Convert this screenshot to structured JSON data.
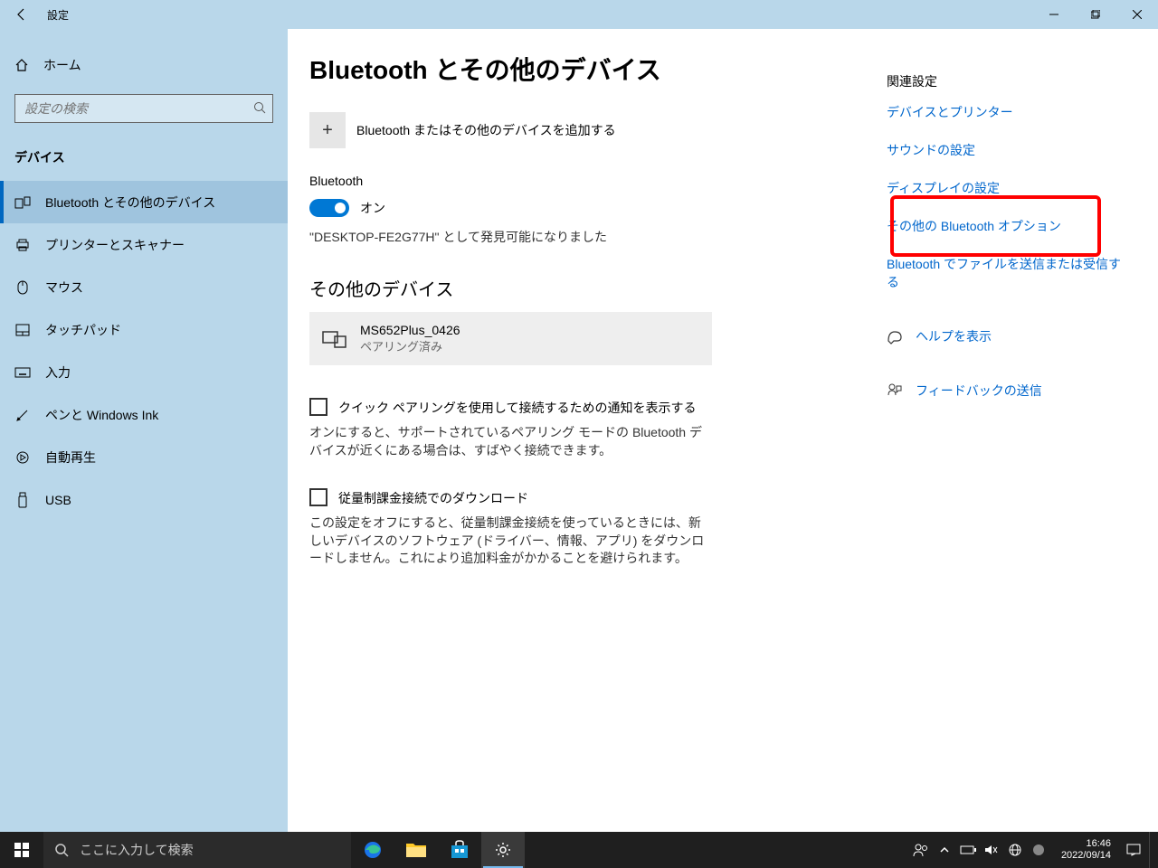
{
  "titlebar": {
    "title": "設定"
  },
  "sidebar": {
    "home": "ホーム",
    "search_placeholder": "設定の検索",
    "category": "デバイス",
    "items": [
      {
        "label": "Bluetooth とその他のデバイス"
      },
      {
        "label": "プリンターとスキャナー"
      },
      {
        "label": "マウス"
      },
      {
        "label": "タッチパッド"
      },
      {
        "label": "入力"
      },
      {
        "label": "ペンと Windows Ink"
      },
      {
        "label": "自動再生"
      },
      {
        "label": "USB"
      }
    ]
  },
  "content": {
    "heading": "Bluetooth とその他のデバイス",
    "add_device": "Bluetooth またはその他のデバイスを追加する",
    "bluetooth_label": "Bluetooth",
    "toggle_state": "オン",
    "discoverable": "\"DESKTOP-FE2G77H\" として発見可能になりました",
    "other_devices_heading": "その他のデバイス",
    "device": {
      "name": "MS652Plus_0426",
      "status": "ペアリング済み"
    },
    "quick_pair_label": "クイック ペアリングを使用して接続するための通知を表示する",
    "quick_pair_desc": "オンにすると、サポートされているペアリング モードの Bluetooth デバイスが近くにある場合は、すばやく接続できます。",
    "metered_label": "従量制課金接続でのダウンロード",
    "metered_desc": "この設定をオフにすると、従量制課金接続を使っているときには、新しいデバイスのソフトウェア (ドライバー、情報、アプリ) をダウンロードしません。これにより追加料金がかかることを避けられます。"
  },
  "related": {
    "heading": "関連設定",
    "links": [
      "デバイスとプリンター",
      "サウンドの設定",
      "ディスプレイの設定",
      "その他の Bluetooth オプション",
      "Bluetooth でファイルを送信または受信する"
    ],
    "help": "ヘルプを表示",
    "feedback": "フィードバックの送信"
  },
  "taskbar": {
    "search_placeholder": "ここに入力して検索",
    "time": "16:46",
    "date": "2022/09/14"
  }
}
